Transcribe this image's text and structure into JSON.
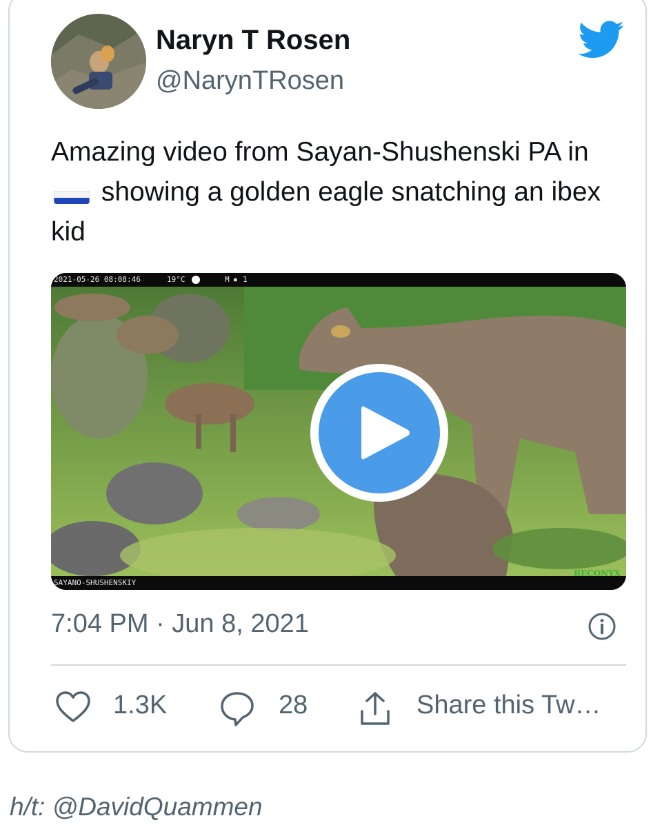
{
  "tweet": {
    "author_name": "Naryn T Rosen",
    "author_handle": "@NarynTRosen",
    "text_part1": "Amazing video from Sayan-Shushenski PA in",
    "flag_icon": "russia-flag-icon",
    "text_part2": "showing a golden eagle snatching an ibex kid",
    "timestamp": "7:04 PM · Jun 8, 2021"
  },
  "video": {
    "cam_timestamp": "2021-05-26 08:08:46",
    "cam_temp": "19°C",
    "cam_mode": "M",
    "cam_channel": "1",
    "cam_location": "SAYANO-SHUSHENSKIY",
    "cam_brand": "RECONYX"
  },
  "actions": {
    "like_count": "1.3K",
    "reply_count": "28",
    "share_label": "Share this Tw…"
  },
  "footer": {
    "credit": "h/t: @DavidQuammen"
  },
  "colors": {
    "twitter_blue": "#1d9bf0",
    "play_blue": "#4a9be8",
    "muted_text": "#536471",
    "border": "#cfd9de"
  }
}
